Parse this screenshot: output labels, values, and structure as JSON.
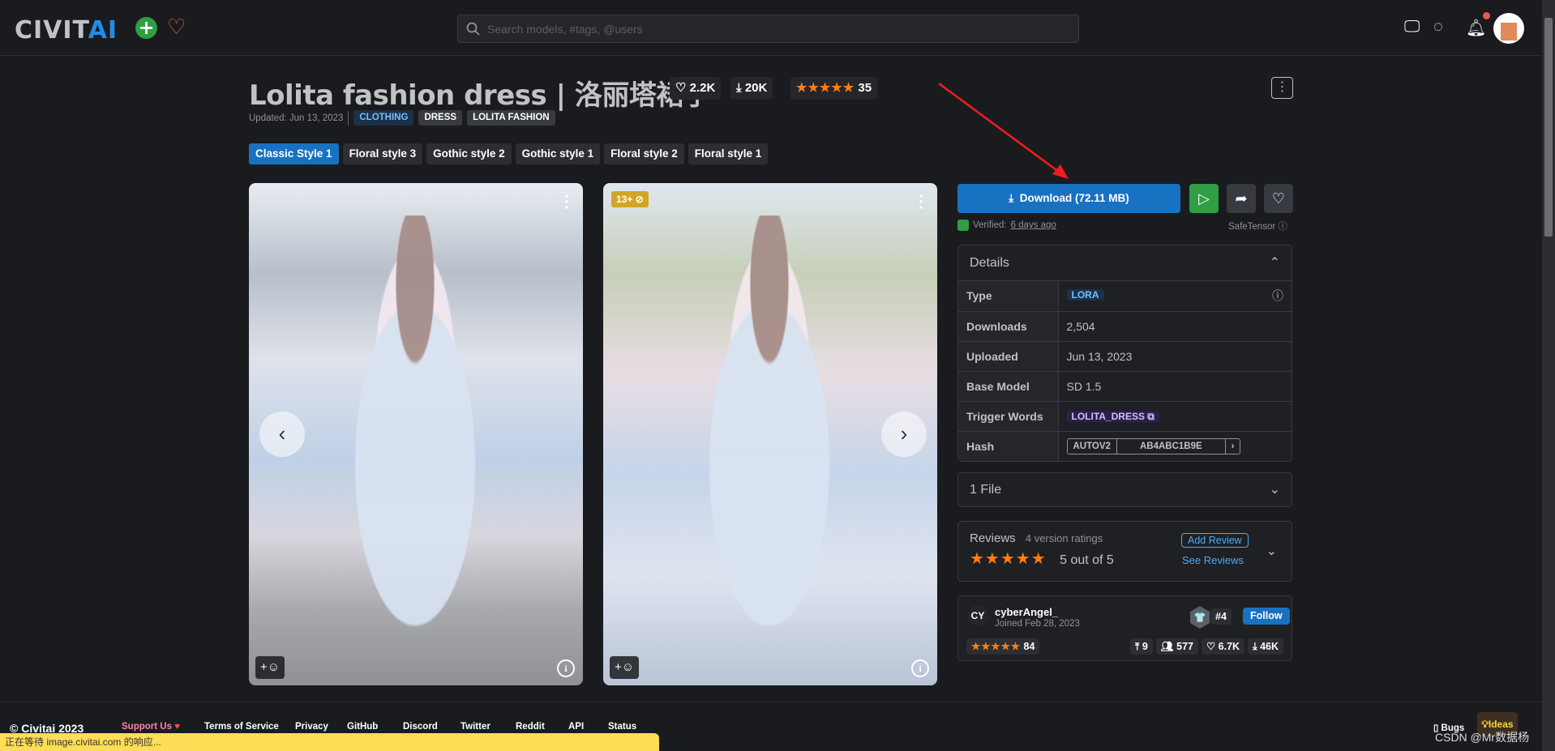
{
  "header": {
    "logo_main": "CIVIT",
    "logo_accent": "AI",
    "search_placeholder": "Search models, #tags, @users"
  },
  "model": {
    "title": "Lolita fashion dress | 洛丽塔裙子",
    "likes": "2.2K",
    "downloads": "20K",
    "rating_stars": 5,
    "rating_count": "35",
    "updated": "Updated: Jun 13, 2023",
    "tags": [
      "CLOTHING",
      "DRESS",
      "LOLITA FASHION"
    ],
    "versions": [
      "Classic Style 1",
      "Floral style 3",
      "Gothic style 2",
      "Gothic style 1",
      "Floral style 2",
      "Floral style 1"
    ],
    "active_version": "Classic Style 1"
  },
  "gallery": {
    "age_badge": "13+"
  },
  "download": {
    "label": "Download (72.11 MB)",
    "verified_label": "Verified:",
    "verified_time": "6 days ago",
    "safetensor": "SafeTensor"
  },
  "details": {
    "title": "Details",
    "rows": [
      {
        "k": "Type",
        "v": "LORA"
      },
      {
        "k": "Downloads",
        "v": "2,504"
      },
      {
        "k": "Uploaded",
        "v": "Jun 13, 2023"
      },
      {
        "k": "Base Model",
        "v": "SD 1.5"
      },
      {
        "k": "Trigger Words",
        "v": "LOLITA_DRESS"
      },
      {
        "k": "Hash",
        "v": "AB4ABC1B9E",
        "hash_type": "AUTOV2"
      }
    ]
  },
  "files": {
    "label": "1 File"
  },
  "reviews": {
    "title": "Reviews",
    "count": "4 version ratings",
    "score": "5 out of 5",
    "add": "Add Review",
    "see": "See Reviews"
  },
  "creator": {
    "initials": "CY",
    "name": "cyberAngel_",
    "joined": "Joined Feb 28, 2023",
    "rank": "#4",
    "follow": "Follow",
    "rating_count": "84",
    "uploads": "9",
    "followers": "577",
    "likes": "6.7K",
    "downloads": "46K"
  },
  "footer": {
    "copyright": "© Civitai 2023",
    "links": [
      "Support Us",
      "Terms of Service",
      "Privacy",
      "GitHub",
      "Discord",
      "Twitter",
      "Reddit",
      "API",
      "Status"
    ],
    "bugs": "Bugs",
    "ideas": "Ideas"
  },
  "status_bar": "正在等待 image.civitai.com 的响应...",
  "watermark": "CSDN @Mr数据杨",
  "colors": {
    "accent": "#1971c2",
    "star": "#fd7e14",
    "green": "#2f9e44",
    "background": "#1a1b1e"
  }
}
